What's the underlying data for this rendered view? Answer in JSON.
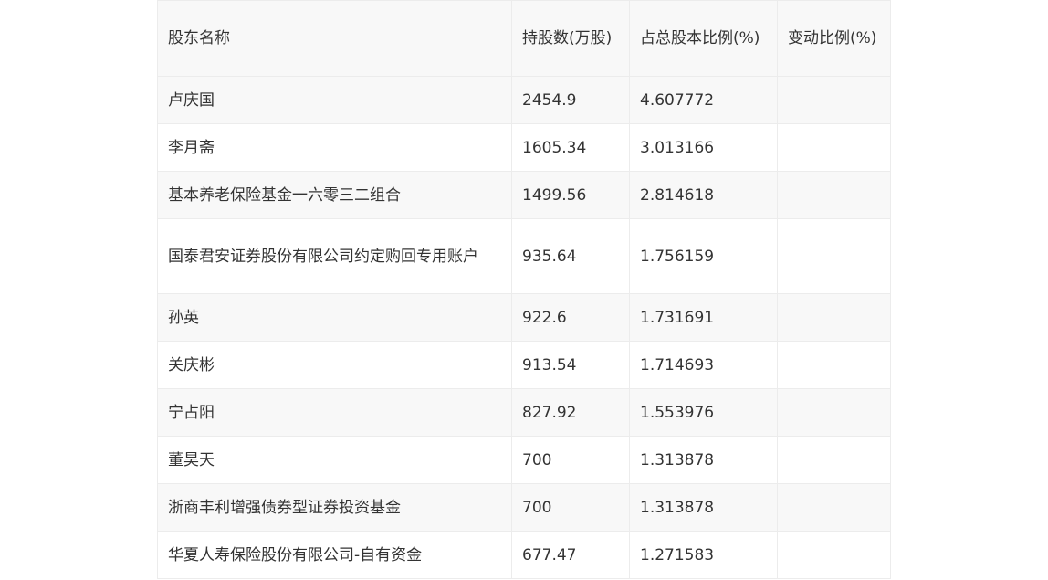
{
  "table": {
    "headers": [
      "股东名称",
      "持股数(万股)",
      "占总股本比例(%)",
      "变动比例(%)"
    ],
    "rows": [
      {
        "name": "卢庆国",
        "shares": "2454.9",
        "ratio": "4.607772",
        "change": ""
      },
      {
        "name": "李月斋",
        "shares": "1605.34",
        "ratio": "3.013166",
        "change": ""
      },
      {
        "name": "基本养老保险基金一六零三二组合",
        "shares": "1499.56",
        "ratio": "2.814618",
        "change": ""
      },
      {
        "name": "国泰君安证券股份有限公司约定购回专用账户",
        "shares": "935.64",
        "ratio": "1.756159",
        "change": ""
      },
      {
        "name": "孙英",
        "shares": "922.6",
        "ratio": "1.731691",
        "change": ""
      },
      {
        "name": "关庆彬",
        "shares": "913.54",
        "ratio": "1.714693",
        "change": ""
      },
      {
        "name": "宁占阳",
        "shares": "827.92",
        "ratio": "1.553976",
        "change": ""
      },
      {
        "name": "董昊天",
        "shares": "700",
        "ratio": "1.313878",
        "change": ""
      },
      {
        "name": "浙商丰利增强债券型证券投资基金",
        "shares": "700",
        "ratio": "1.313878",
        "change": ""
      },
      {
        "name": "华夏人寿保险股份有限公司-自有资金",
        "shares": "677.47",
        "ratio": "1.271583",
        "change": ""
      }
    ]
  }
}
